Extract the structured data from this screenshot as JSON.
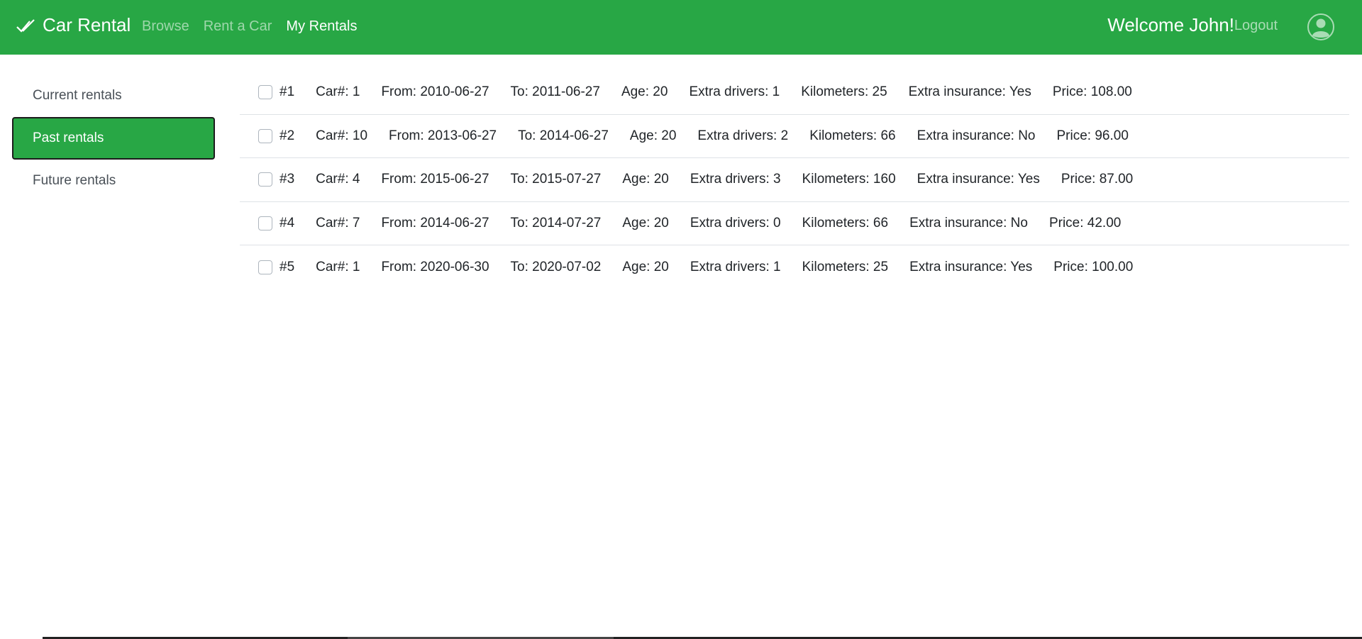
{
  "header": {
    "brand": "Car Rental",
    "nav": [
      {
        "label": "Browse",
        "active": false
      },
      {
        "label": "Rent a Car",
        "active": false
      },
      {
        "label": "My Rentals",
        "active": true
      }
    ],
    "welcome": "Welcome John!",
    "logout": "Logout"
  },
  "sidebar": {
    "items": [
      {
        "label": "Current rentals",
        "active": false
      },
      {
        "label": "Past rentals",
        "active": true
      },
      {
        "label": "Future rentals",
        "active": false
      }
    ]
  },
  "rentals": [
    {
      "id": "#1",
      "car": "Car#: 1",
      "from": "From: 2010-06-27",
      "to": "To: 2011-06-27",
      "age": "Age: 20",
      "drivers": "Extra drivers: 1",
      "km": "Kilometers: 25",
      "insurance": "Extra insurance: Yes",
      "price": "Price: 108.00"
    },
    {
      "id": "#2",
      "car": "Car#: 10",
      "from": "From: 2013-06-27",
      "to": "To: 2014-06-27",
      "age": "Age: 20",
      "drivers": "Extra drivers: 2",
      "km": "Kilometers: 66",
      "insurance": "Extra insurance: No",
      "price": "Price: 96.00"
    },
    {
      "id": "#3",
      "car": "Car#: 4",
      "from": "From: 2015-06-27",
      "to": "To: 2015-07-27",
      "age": "Age: 20",
      "drivers": "Extra drivers: 3",
      "km": "Kilometers: 160",
      "insurance": "Extra insurance: Yes",
      "price": "Price: 87.00"
    },
    {
      "id": "#4",
      "car": "Car#: 7",
      "from": "From: 2014-06-27",
      "to": "To: 2014-07-27",
      "age": "Age: 20",
      "drivers": "Extra drivers: 0",
      "km": "Kilometers: 66",
      "insurance": "Extra insurance: No",
      "price": "Price: 42.00"
    },
    {
      "id": "#5",
      "car": "Car#: 1",
      "from": "From: 2020-06-30",
      "to": "To: 2020-07-02",
      "age": "Age: 20",
      "drivers": "Extra drivers: 1",
      "km": "Kilometers: 25",
      "insurance": "Extra insurance: Yes",
      "price": "Price: 100.00"
    }
  ],
  "colors": {
    "brand_green": "#28a745",
    "active_border": "#1c1c1c"
  },
  "icons": {
    "brand": "double-check-icon",
    "avatar": "user-circle-icon"
  }
}
